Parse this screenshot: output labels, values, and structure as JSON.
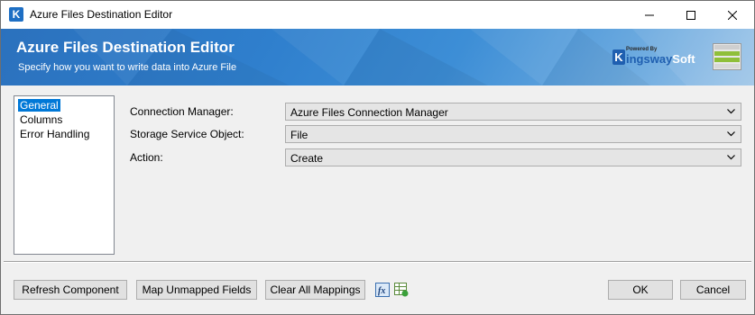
{
  "window": {
    "title": "Azure Files Destination Editor",
    "app_icon_letter": "K"
  },
  "banner": {
    "title": "Azure Files Destination Editor",
    "subtitle": "Specify how you want to write data into Azure File",
    "logo_powered_by": "Powered By",
    "logo_k": "K",
    "logo_word": "ingsway",
    "logo_word2": "Soft"
  },
  "nav": {
    "items": [
      {
        "label": "General",
        "selected": true
      },
      {
        "label": "Columns",
        "selected": false
      },
      {
        "label": "Error Handling",
        "selected": false
      }
    ]
  },
  "form": {
    "connection_manager": {
      "label": "Connection Manager:",
      "value": "Azure Files Connection Manager"
    },
    "storage_object": {
      "label": "Storage Service Object:",
      "value": "File"
    },
    "action": {
      "label": "Action:",
      "value": "Create"
    }
  },
  "buttons": {
    "refresh": "Refresh Component",
    "map_unmapped": "Map Unmapped Fields",
    "clear_mappings": "Clear All Mappings",
    "ok": "OK",
    "cancel": "Cancel"
  },
  "colors": {
    "accent": "#0078d7",
    "banner_blue": "#2f7fcd"
  }
}
